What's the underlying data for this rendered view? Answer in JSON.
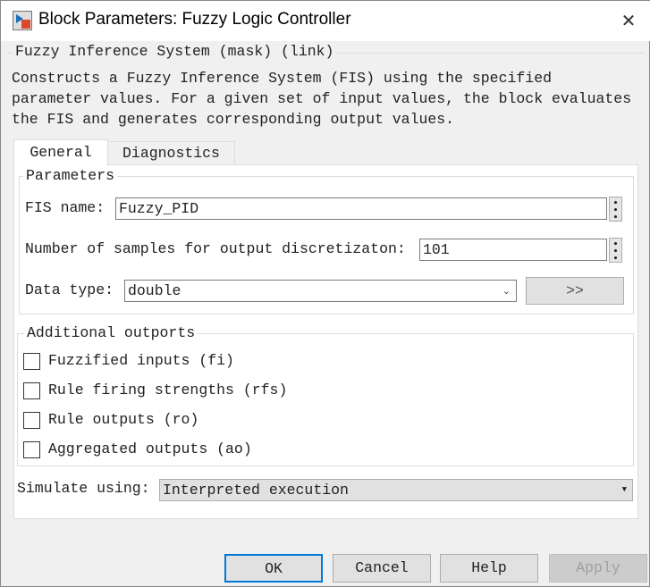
{
  "window": {
    "title": "Block Parameters: Fuzzy Logic Controller",
    "close_icon": "close-icon"
  },
  "mask": {
    "header": "Fuzzy Inference System (mask) (link)",
    "description": [
      "Constructs a Fuzzy Inference System (FIS) using the specified",
      "parameter values. For a given set of input values, the block evaluates",
      "the FIS and generates corresponding output values."
    ]
  },
  "tabs": [
    {
      "label": "General",
      "active": true
    },
    {
      "label": "Diagnostics",
      "active": false
    }
  ],
  "parameters": {
    "group_label": "Parameters",
    "fis_name_label": "FIS name:",
    "fis_name_value": "Fuzzy_PID",
    "samples_label": "Number of samples for output discretizaton:",
    "samples_value": "101",
    "data_type_label": "Data type:",
    "data_type_value": "double",
    "expand_label": ">>"
  },
  "outports": {
    "group_label": "Additional outports",
    "items": [
      {
        "label": "Fuzzified inputs (fi)",
        "checked": false
      },
      {
        "label": "Rule firing strengths (rfs)",
        "checked": false
      },
      {
        "label": "Rule outputs (ro)",
        "checked": false
      },
      {
        "label": "Aggregated outputs (ao)",
        "checked": false
      }
    ]
  },
  "simulate": {
    "label": "Simulate using:",
    "value": "Interpreted execution"
  },
  "buttons": {
    "ok": "OK",
    "cancel": "Cancel",
    "help": "Help",
    "apply": "Apply"
  }
}
